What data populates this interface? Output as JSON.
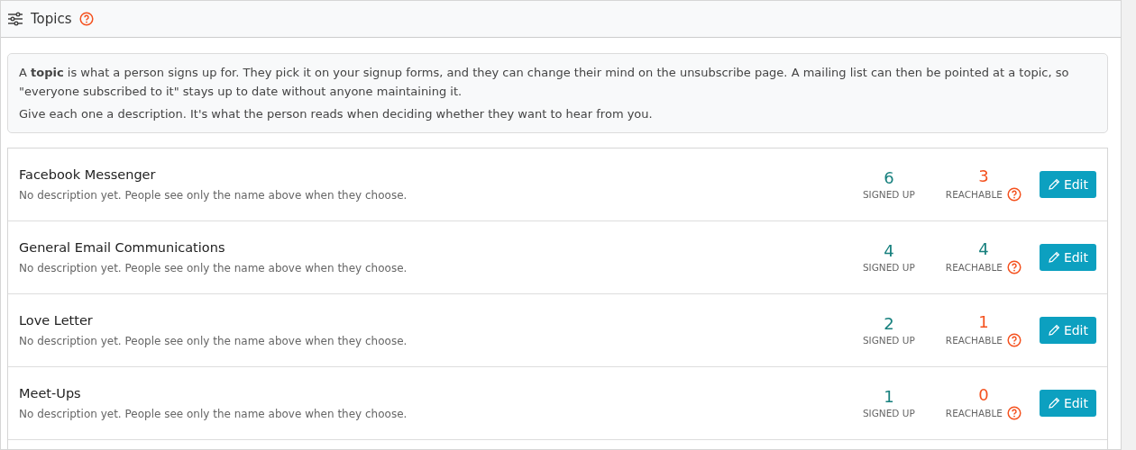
{
  "header": {
    "title": "Topics"
  },
  "intro": {
    "paragraphs": [
      "A **topic** is what a person signs up for. They pick it on your signup forms, and they can change their mind on the unsubscribe page. A mailing list can then be pointed at a topic, so \"everyone subscribed to it\" stays up to date without anyone maintaining it.",
      "Give each one a description. It's what the person reads when deciding whether they want to hear from you."
    ]
  },
  "topics": [
    {
      "name": "Facebook Messenger",
      "description": "No description yet. People see only the name above when they choose.",
      "signed_up": {
        "value": "6",
        "label": "SIGNED UP"
      },
      "reachable": {
        "value": "3",
        "label": "REACHABLE",
        "color": "#f4511e"
      },
      "button": "Edit"
    },
    {
      "name": "General Email Communications",
      "description": "No description yet. People see only the name above when they choose.",
      "signed_up": {
        "value": "4",
        "label": "SIGNED UP"
      },
      "reachable": {
        "value": "4",
        "label": "REACHABLE",
        "color": "#17807e"
      },
      "button": "Edit"
    },
    {
      "name": "Love Letter",
      "description": "No description yet. People see only the name above when they choose.",
      "signed_up": {
        "value": "2",
        "label": "SIGNED UP"
      },
      "reachable": {
        "value": "1",
        "label": "REACHABLE",
        "color": "#f4511e"
      },
      "button": "Edit"
    },
    {
      "name": "Meet-Ups",
      "description": "No description yet. People see only the name above when they choose.",
      "signed_up": {
        "value": "1",
        "label": "SIGNED UP"
      },
      "reachable": {
        "value": "0",
        "label": "REACHABLE",
        "color": "#f4511e"
      },
      "button": "Edit"
    }
  ]
}
